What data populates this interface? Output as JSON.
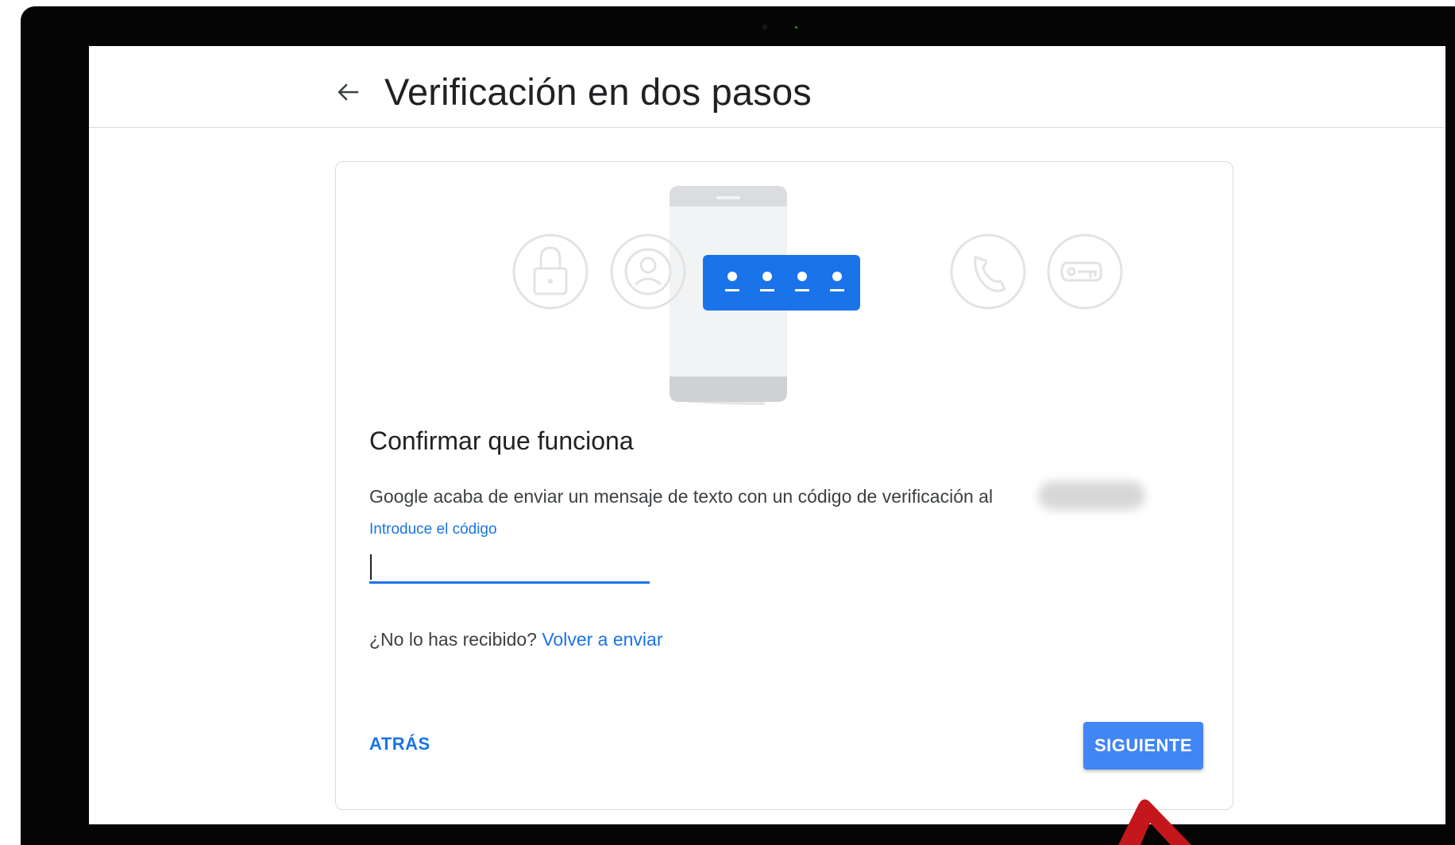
{
  "header": {
    "title": "Verificación en dos pasos",
    "back_icon": "arrow-left-icon"
  },
  "card": {
    "illustration_icons": [
      "lock-icon",
      "account-circle-icon",
      "phone-code-icon",
      "phone-call-icon",
      "key-icon"
    ],
    "heading": "Confirmar que funciona",
    "description": "Google acaba de enviar un mensaje de texto con un código de verificación al",
    "input": {
      "label": "Introduce el código",
      "value": ""
    },
    "resend": {
      "question": "¿No lo has recibido?",
      "link": "Volver a enviar"
    },
    "buttons": {
      "back": "ATRÁS",
      "next": "SIGUIENTE"
    }
  },
  "colors": {
    "accent": "#1a73e8",
    "primary_button": "#4285f4",
    "annotation_arrow": "#c4171c"
  }
}
